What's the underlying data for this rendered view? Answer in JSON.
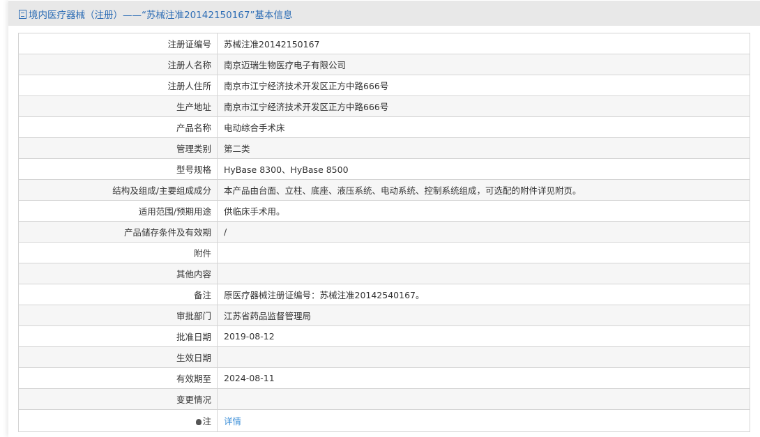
{
  "header": {
    "title": "境内医疗器械（注册）——“苏械注准20142150167”基本信息",
    "icon": "document-icon"
  },
  "rows": [
    {
      "label": "注册证编号",
      "value": "苏械注准20142150167"
    },
    {
      "label": "注册人名称",
      "value": "南京迈瑞生物医疗电子有限公司"
    },
    {
      "label": "注册人住所",
      "value": "南京市江宁经济技术开发区正方中路666号"
    },
    {
      "label": "生产地址",
      "value": "南京市江宁经济技术开发区正方中路666号"
    },
    {
      "label": "产品名称",
      "value": "电动综合手术床"
    },
    {
      "label": "管理类别",
      "value": "第二类"
    },
    {
      "label": "型号规格",
      "value": "HyBase 8300、HyBase 8500"
    },
    {
      "label": "结构及组成/主要组成成分",
      "value": "本产品由台面、立柱、底座、液压系统、电动系统、控制系统组成，可选配的附件详见附页。"
    },
    {
      "label": "适用范围/预期用途",
      "value": "供临床手术用。"
    },
    {
      "label": "产品储存条件及有效期",
      "value": "/"
    },
    {
      "label": "附件",
      "value": ""
    },
    {
      "label": "其他内容",
      "value": ""
    },
    {
      "label": "备注",
      "value": "原医疗器械注册证编号：苏械注准20142540167。"
    },
    {
      "label": "审批部门",
      "value": "江苏省药品监督管理局"
    },
    {
      "label": "批准日期",
      "value": "2019-08-12"
    },
    {
      "label": "生效日期",
      "value": ""
    },
    {
      "label": "有效期至",
      "value": "2024-08-11"
    },
    {
      "label": "变更情况",
      "value": ""
    }
  ],
  "note": {
    "label": "注",
    "link": "详情",
    "icon": "lightbulb-icon"
  }
}
